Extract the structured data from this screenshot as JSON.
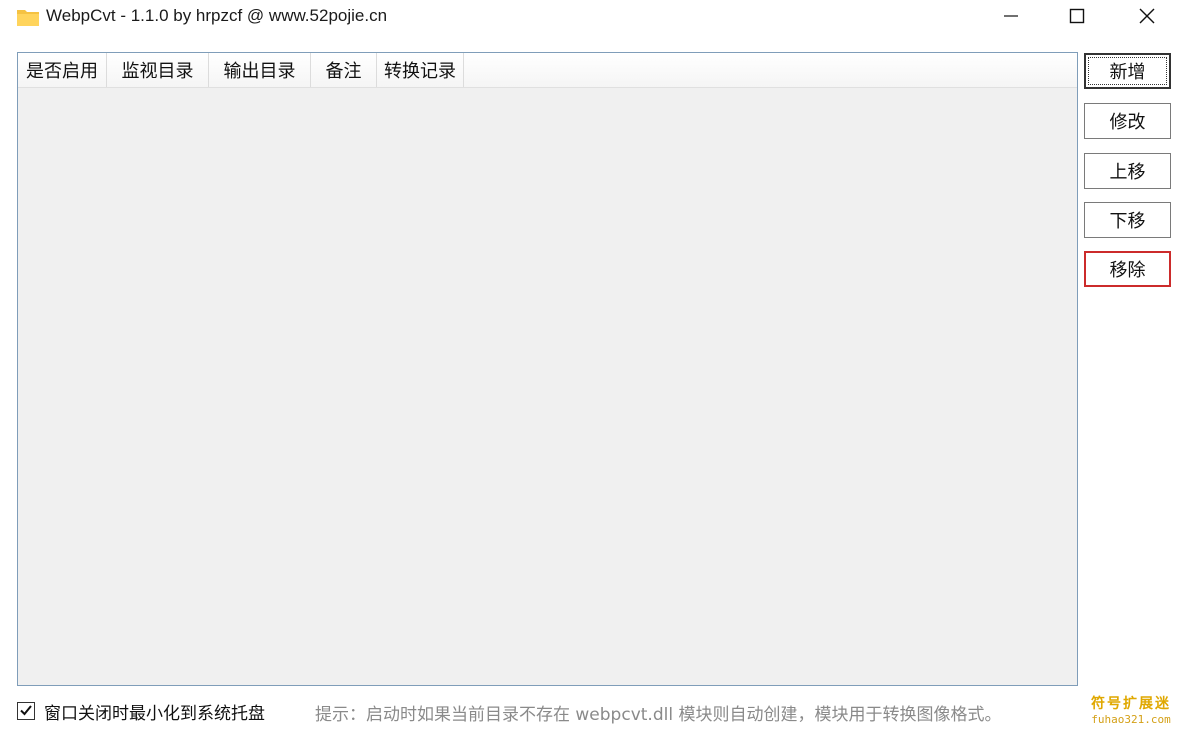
{
  "window": {
    "title": "WebpCvt - 1.1.0 by hrpzcf @ www.52pojie.cn",
    "controls": {
      "minimize": "minimize-icon",
      "maximize": "maximize-icon",
      "close": "close-icon"
    }
  },
  "list": {
    "columns": [
      "是否启用",
      "监视目录",
      "输出目录",
      "备注",
      "转换记录"
    ],
    "rows": []
  },
  "buttons": {
    "add": "新增",
    "edit": "修改",
    "move_up": "上移",
    "move_down": "下移",
    "remove": "移除"
  },
  "footer": {
    "minimize_to_tray_label": "窗口关闭时最小化到系统托盘",
    "minimize_to_tray_checked": true,
    "hint": "提示：启动时如果当前目录不存在 webpcvt.dll 模块则自动创建，模块用于转换图像格式。"
  },
  "watermark": {
    "top": "符号扩展迷",
    "bottom": "fuhao321.com"
  },
  "colors": {
    "remove_border": "#cc2b2b",
    "list_border": "#7f9db9",
    "list_background": "#f0f0f0",
    "folder_icon": "#f5c242"
  }
}
